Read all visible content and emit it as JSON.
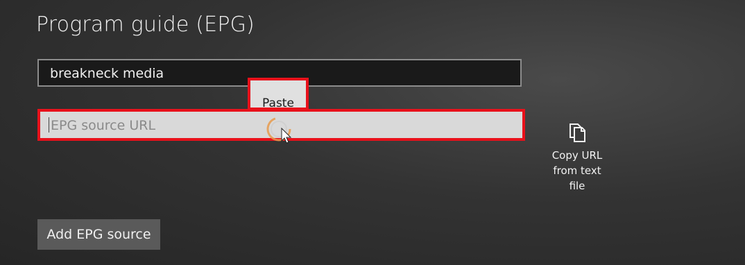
{
  "page": {
    "title": "Program guide (EPG)"
  },
  "form": {
    "name_value": "breakneck media",
    "url_placeholder": "EPG source URL"
  },
  "context_menu": {
    "paste_label": "Paste"
  },
  "copy_action": {
    "label_lines": [
      "Copy URL",
      "from text",
      "file"
    ],
    "icon": "copy-icon"
  },
  "actions": {
    "add_label": "Add EPG source"
  },
  "colors": {
    "highlight": "#e8111b",
    "button_bg": "#5a5a5a"
  }
}
